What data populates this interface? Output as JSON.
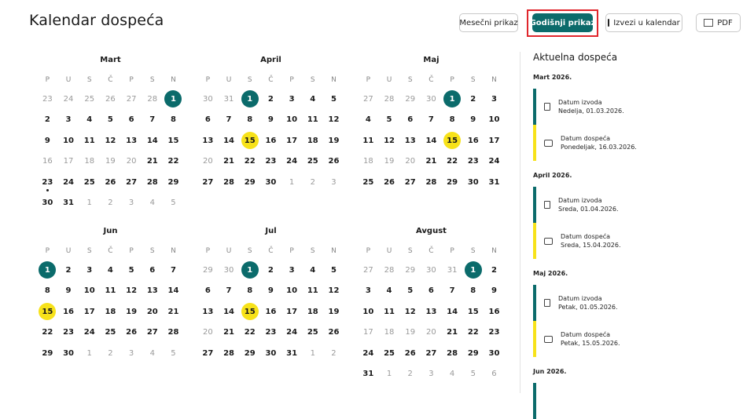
{
  "header": {
    "title": "Kalendar dospeća",
    "buttons": {
      "monthly": "Mesečni prikaz",
      "yearly": "Godišnji prikaz",
      "export": "Izvezi u kalendar",
      "pdf": "PDF"
    }
  },
  "weekdays": [
    "P",
    "U",
    "S",
    "Č",
    "P",
    "S",
    "N"
  ],
  "months": [
    {
      "name": "Mart",
      "weeks": [
        [
          "23",
          "24",
          "25",
          "26",
          "27",
          "28",
          "1"
        ],
        [
          "2",
          "3",
          "4",
          "5",
          "6",
          "7",
          "8"
        ],
        [
          "9",
          "10",
          "11",
          "12",
          "13",
          "14",
          "15"
        ],
        [
          "16",
          "17",
          "18",
          "19",
          "20",
          "21",
          "22"
        ],
        [
          "23",
          "24",
          "25",
          "26",
          "27",
          "28",
          "29"
        ],
        [
          "30",
          "31",
          "1",
          "2",
          "3",
          "4",
          "5"
        ]
      ]
    },
    {
      "name": "April",
      "weeks": [
        [
          "30",
          "31",
          "1",
          "2",
          "3",
          "4",
          "5"
        ],
        [
          "6",
          "7",
          "8",
          "9",
          "10",
          "11",
          "12"
        ],
        [
          "13",
          "14",
          "15",
          "16",
          "17",
          "18",
          "19"
        ],
        [
          "20",
          "21",
          "22",
          "23",
          "24",
          "25",
          "26"
        ],
        [
          "27",
          "28",
          "29",
          "30",
          "1",
          "2",
          "3"
        ]
      ]
    },
    {
      "name": "Maj",
      "weeks": [
        [
          "27",
          "28",
          "29",
          "30",
          "1",
          "2",
          "3"
        ],
        [
          "4",
          "5",
          "6",
          "7",
          "8",
          "9",
          "10"
        ],
        [
          "11",
          "12",
          "13",
          "14",
          "15",
          "16",
          "17"
        ],
        [
          "18",
          "19",
          "20",
          "21",
          "22",
          "23",
          "24"
        ],
        [
          "25",
          "26",
          "27",
          "28",
          "29",
          "30",
          "31"
        ]
      ]
    },
    {
      "name": "Jun",
      "weeks": [
        [
          "1",
          "2",
          "3",
          "4",
          "5",
          "6",
          "7"
        ],
        [
          "8",
          "9",
          "10",
          "11",
          "12",
          "13",
          "14"
        ],
        [
          "15",
          "16",
          "17",
          "18",
          "19",
          "20",
          "21"
        ],
        [
          "22",
          "23",
          "24",
          "25",
          "26",
          "27",
          "28"
        ],
        [
          "29",
          "30",
          "1",
          "2",
          "3",
          "4",
          "5"
        ]
      ]
    },
    {
      "name": "Jul",
      "weeks": [
        [
          "29",
          "30",
          "1",
          "2",
          "3",
          "4",
          "5"
        ],
        [
          "6",
          "7",
          "8",
          "9",
          "10",
          "11",
          "12"
        ],
        [
          "13",
          "14",
          "15",
          "16",
          "17",
          "18",
          "19"
        ],
        [
          "20",
          "21",
          "22",
          "23",
          "24",
          "25",
          "26"
        ],
        [
          "27",
          "28",
          "29",
          "30",
          "31",
          "1",
          "2"
        ]
      ]
    },
    {
      "name": "Avgust",
      "weeks": [
        [
          "27",
          "28",
          "29",
          "30",
          "31",
          "1",
          "2"
        ],
        [
          "3",
          "4",
          "5",
          "6",
          "7",
          "8",
          "9"
        ],
        [
          "10",
          "11",
          "12",
          "13",
          "14",
          "15",
          "16"
        ],
        [
          "17",
          "18",
          "19",
          "20",
          "21",
          "22",
          "23"
        ],
        [
          "24",
          "25",
          "26",
          "27",
          "28",
          "29",
          "30"
        ],
        [
          "31",
          "1",
          "2",
          "3",
          "4",
          "5",
          "6"
        ]
      ]
    }
  ],
  "sidebar": {
    "title": "Aktuelna dospeća",
    "groups": [
      {
        "label": "Mart 2026.",
        "events": [
          {
            "type": "izvod",
            "color": "#0b6b6b",
            "title": "Datum izvoda",
            "date": "Nedelja, 01.03.2026."
          },
          {
            "type": "dospece",
            "color": "#f7e21a",
            "title": "Datum dospeća",
            "date": "Ponedeljak, 16.03.2026."
          }
        ]
      },
      {
        "label": "April 2026.",
        "events": [
          {
            "type": "izvod",
            "color": "#0b6b6b",
            "title": "Datum izvoda",
            "date": "Sreda, 01.04.2026."
          },
          {
            "type": "dospece",
            "color": "#f7e21a",
            "title": "Datum dospeća",
            "date": "Sreda, 15.04.2026."
          }
        ]
      },
      {
        "label": "Maj 2026.",
        "events": [
          {
            "type": "izvod",
            "color": "#0b6b6b",
            "title": "Datum izvoda",
            "date": "Petak, 01.05.2026."
          },
          {
            "type": "dospece",
            "color": "#f7e21a",
            "title": "Datum dospeća",
            "date": "Petak, 15.05.2026."
          }
        ]
      },
      {
        "label": "Jun 2026.",
        "events": [
          {
            "type": "izvod",
            "color": "#0b6b6b",
            "title": "",
            "date": ""
          }
        ]
      }
    ]
  },
  "colors": {
    "teal": "#0b6b6b",
    "yellow": "#f7e21a",
    "highlight": "#e0262c"
  }
}
